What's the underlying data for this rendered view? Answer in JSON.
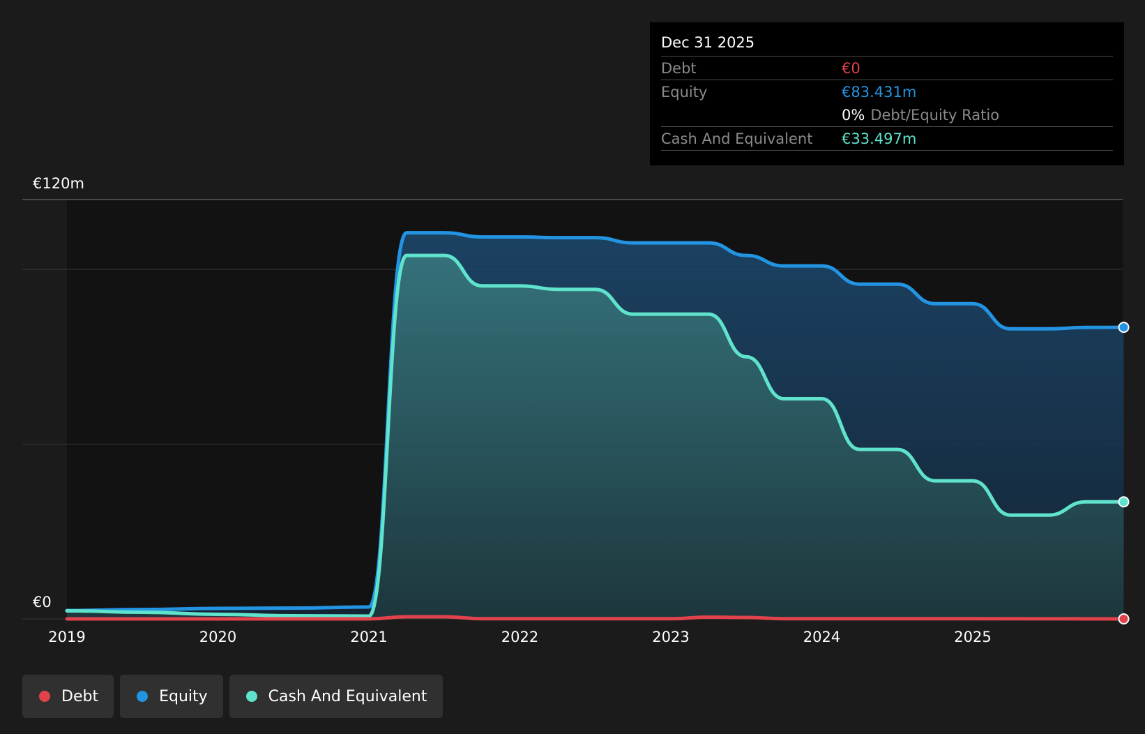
{
  "colors": {
    "debt": "#e0434b",
    "equity": "#2394e2",
    "cash": "#5fe3cc",
    "background": "#1b1b1b",
    "plot_past": "#1b1b1b",
    "plot_recent": "#121212"
  },
  "tooltip": {
    "date": "Dec 31 2025",
    "debt_label": "Debt",
    "debt_value": "€0",
    "equity_label": "Equity",
    "equity_value": "€83.431m",
    "ratio_value": "0%",
    "ratio_label": "Debt/Equity Ratio",
    "cash_label": "Cash And Equivalent",
    "cash_value": "€33.497m"
  },
  "legend": [
    {
      "label": "Debt",
      "color": "#e0434b"
    },
    {
      "label": "Equity",
      "color": "#2394e2"
    },
    {
      "label": "Cash And Equivalent",
      "color": "#5fe3cc"
    }
  ],
  "chart_data": {
    "type": "area",
    "y_top_label": "€120m",
    "y_zero_label": "€0",
    "ylim": [
      0,
      120
    ],
    "xlim": [
      2019,
      2026
    ],
    "x_ticks": [
      2019,
      2020,
      2021,
      2022,
      2023,
      2024,
      2025
    ],
    "x_tick_labels": [
      "2019",
      "2020",
      "2021",
      "2022",
      "2023",
      "2024",
      "2025"
    ],
    "gridlines": [
      0,
      50,
      100,
      120
    ],
    "series": [
      {
        "name": "Equity",
        "points": [
          [
            2019.0,
            2.4
          ],
          [
            2019.5,
            2.7
          ],
          [
            2020.0,
            3.0
          ],
          [
            2020.5,
            3.1
          ],
          [
            2021.0,
            3.4
          ],
          [
            2021.25,
            110.5
          ],
          [
            2021.5,
            110.5
          ],
          [
            2021.75,
            109.3
          ],
          [
            2022.0,
            109.3
          ],
          [
            2022.25,
            109.1
          ],
          [
            2022.5,
            109.1
          ],
          [
            2022.75,
            107.6
          ],
          [
            2023.0,
            107.6
          ],
          [
            2023.25,
            107.6
          ],
          [
            2023.5,
            104.0
          ],
          [
            2023.75,
            101.0
          ],
          [
            2024.0,
            101.0
          ],
          [
            2024.25,
            95.8
          ],
          [
            2024.5,
            95.8
          ],
          [
            2024.75,
            90.2
          ],
          [
            2025.0,
            90.2
          ],
          [
            2025.25,
            83.0
          ],
          [
            2025.5,
            83.0
          ],
          [
            2025.75,
            83.4
          ],
          [
            2026.0,
            83.431
          ]
        ]
      },
      {
        "name": "Cash And Equivalent",
        "points": [
          [
            2019.0,
            2.3
          ],
          [
            2019.5,
            1.9
          ],
          [
            2020.0,
            1.3
          ],
          [
            2020.5,
            0.9
          ],
          [
            2021.0,
            0.8
          ],
          [
            2021.25,
            104.0
          ],
          [
            2021.5,
            104.0
          ],
          [
            2021.75,
            95.3
          ],
          [
            2022.0,
            95.3
          ],
          [
            2022.25,
            94.3
          ],
          [
            2022.5,
            94.3
          ],
          [
            2022.75,
            87.2
          ],
          [
            2023.0,
            87.2
          ],
          [
            2023.25,
            87.2
          ],
          [
            2023.5,
            75.0
          ],
          [
            2023.75,
            63.0
          ],
          [
            2024.0,
            63.0
          ],
          [
            2024.25,
            48.5
          ],
          [
            2024.5,
            48.5
          ],
          [
            2024.75,
            39.5
          ],
          [
            2025.0,
            39.5
          ],
          [
            2025.25,
            29.7
          ],
          [
            2025.5,
            29.7
          ],
          [
            2025.75,
            33.5
          ],
          [
            2026.0,
            33.497
          ]
        ]
      },
      {
        "name": "Debt",
        "points": [
          [
            2019.0,
            0.0
          ],
          [
            2020.0,
            0.0
          ],
          [
            2021.0,
            0.0
          ],
          [
            2021.25,
            0.6
          ],
          [
            2021.5,
            0.6
          ],
          [
            2021.75,
            0.05
          ],
          [
            2022.0,
            0.05
          ],
          [
            2023.0,
            0.05
          ],
          [
            2023.25,
            0.5
          ],
          [
            2023.5,
            0.4
          ],
          [
            2023.75,
            0.05
          ],
          [
            2024.0,
            0.05
          ],
          [
            2025.0,
            0.05
          ],
          [
            2026.0,
            0.0
          ]
        ]
      }
    ]
  }
}
